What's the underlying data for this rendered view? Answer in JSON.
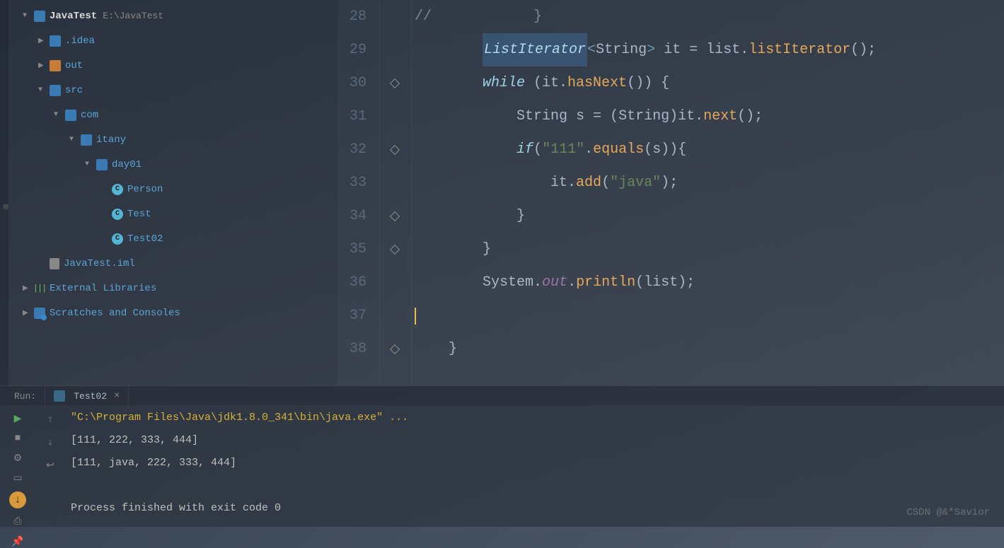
{
  "sidebar": {
    "project": {
      "name": "JavaTest",
      "path": "E:\\JavaTest"
    },
    "items": [
      {
        "label": ".idea",
        "indent": 1,
        "icon": "folder",
        "arrow": "right"
      },
      {
        "label": "out",
        "indent": 1,
        "icon": "folder-orange",
        "arrow": "right"
      },
      {
        "label": "src",
        "indent": 1,
        "icon": "folder",
        "arrow": "down"
      },
      {
        "label": "com",
        "indent": 2,
        "icon": "folder",
        "arrow": "down"
      },
      {
        "label": "itany",
        "indent": 3,
        "icon": "folder",
        "arrow": "down"
      },
      {
        "label": "day01",
        "indent": 4,
        "icon": "folder",
        "arrow": "down"
      },
      {
        "label": "Person",
        "indent": 5,
        "icon": "class",
        "arrow": ""
      },
      {
        "label": "Test",
        "indent": 5,
        "icon": "class",
        "arrow": ""
      },
      {
        "label": "Test02",
        "indent": 5,
        "icon": "class",
        "arrow": ""
      },
      {
        "label": "JavaTest.iml",
        "indent": 1,
        "icon": "file",
        "arrow": ""
      }
    ],
    "external": "External Libraries",
    "scratches": "Scratches and Consoles"
  },
  "editor": {
    "lines": [
      {
        "num": "28",
        "tokens": [
          [
            "comment",
            "//            }"
          ]
        ]
      },
      {
        "num": "29",
        "tokens": [
          [
            "plain",
            "        "
          ],
          [
            "type-hl",
            "ListIterator"
          ],
          [
            "generic",
            "<"
          ],
          [
            "class-ref",
            "String"
          ],
          [
            "generic",
            ">"
          ],
          [
            "plain",
            " it = list."
          ],
          [
            "method",
            "listIterator"
          ],
          [
            "plain",
            "();"
          ]
        ]
      },
      {
        "num": "30",
        "tokens": [
          [
            "plain",
            "        "
          ],
          [
            "keyword",
            "while"
          ],
          [
            "plain",
            " (it."
          ],
          [
            "method",
            "hasNext"
          ],
          [
            "plain",
            "()) {"
          ]
        ]
      },
      {
        "num": "31",
        "tokens": [
          [
            "plain",
            "            "
          ],
          [
            "class-ref",
            "String"
          ],
          [
            "plain",
            " s = ("
          ],
          [
            "class-ref",
            "String"
          ],
          [
            "plain",
            ")it."
          ],
          [
            "method",
            "next"
          ],
          [
            "plain",
            "();"
          ]
        ]
      },
      {
        "num": "32",
        "tokens": [
          [
            "plain",
            "            "
          ],
          [
            "keyword",
            "if"
          ],
          [
            "plain",
            "("
          ],
          [
            "string",
            "\"111\""
          ],
          [
            "plain",
            "."
          ],
          [
            "method",
            "equals"
          ],
          [
            "plain",
            "(s)){"
          ]
        ]
      },
      {
        "num": "33",
        "tokens": [
          [
            "plain",
            "                it."
          ],
          [
            "method",
            "add"
          ],
          [
            "plain",
            "("
          ],
          [
            "string",
            "\"java\""
          ],
          [
            "plain",
            ");"
          ]
        ]
      },
      {
        "num": "34",
        "tokens": [
          [
            "plain",
            "            }"
          ]
        ]
      },
      {
        "num": "35",
        "tokens": [
          [
            "plain",
            "        }"
          ]
        ]
      },
      {
        "num": "36",
        "tokens": [
          [
            "plain",
            "        "
          ],
          [
            "class-ref",
            "System"
          ],
          [
            "plain",
            "."
          ],
          [
            "field-static",
            "out"
          ],
          [
            "plain",
            "."
          ],
          [
            "method",
            "println"
          ],
          [
            "plain",
            "(list);"
          ]
        ]
      },
      {
        "num": "37",
        "tokens": [
          [
            "cursor",
            ""
          ]
        ]
      },
      {
        "num": "38",
        "tokens": [
          [
            "plain",
            "    }"
          ]
        ]
      }
    ]
  },
  "run": {
    "label": "Run:",
    "tab": "Test02",
    "command": "\"C:\\Program Files\\Java\\jdk1.8.0_341\\bin\\java.exe\" ...",
    "output": [
      "[111, 222, 333, 444]",
      "[111, java, 222, 333, 444]",
      "",
      "Process finished with exit code 0"
    ]
  },
  "watermark": "CSDN @&*Savior"
}
